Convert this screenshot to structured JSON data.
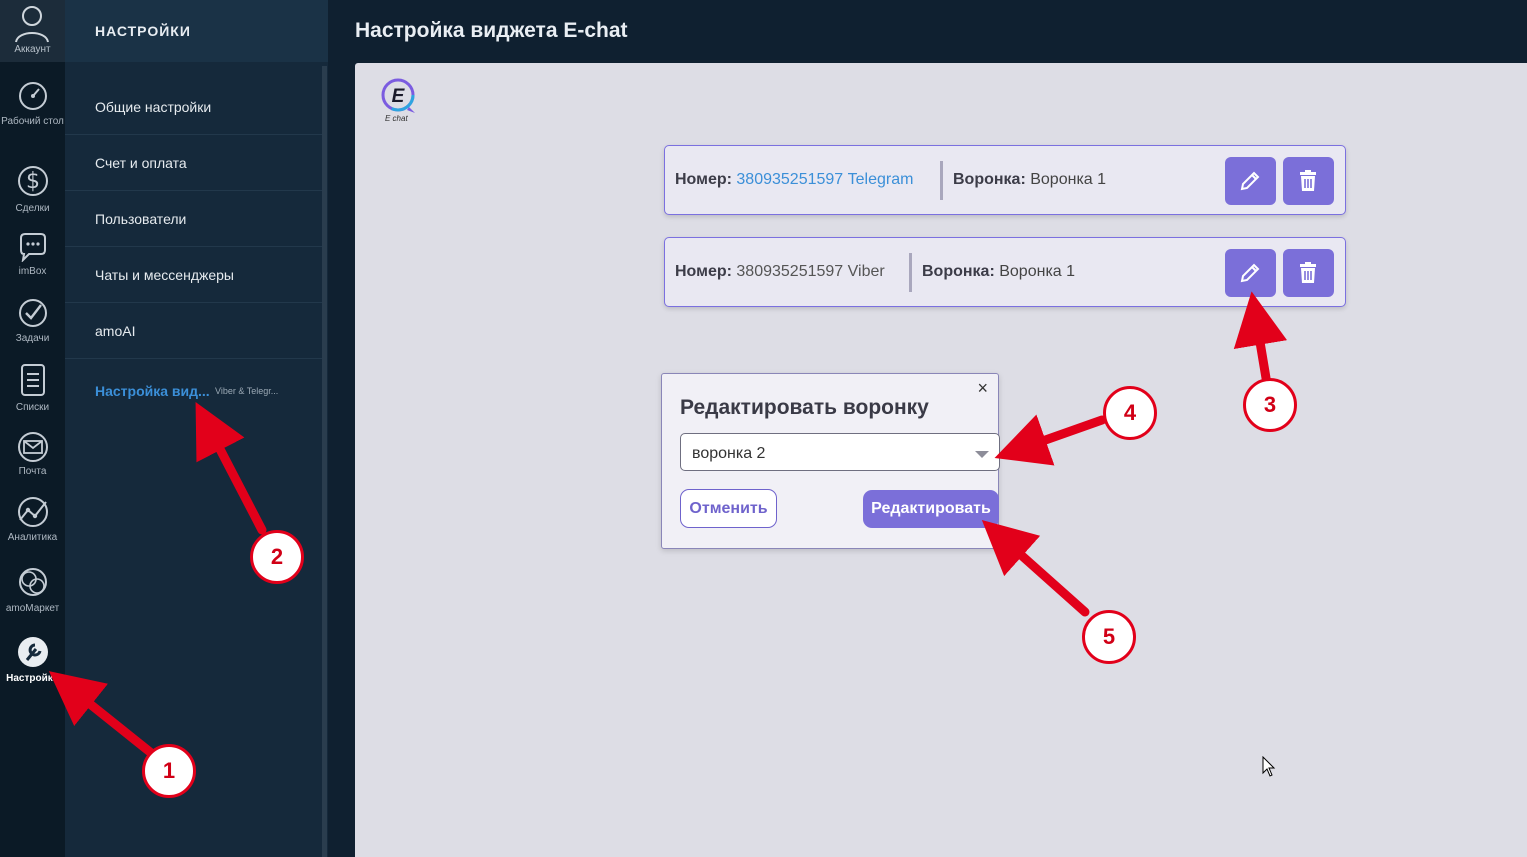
{
  "rail": {
    "account_label": "Аккаунт",
    "items": [
      {
        "label": "Рабочий стол",
        "icon": "dashboard-icon"
      },
      {
        "label": "Сделки",
        "icon": "dollar-icon"
      },
      {
        "label": "imBox",
        "icon": "chat-icon"
      },
      {
        "label": "Задачи",
        "icon": "check-icon"
      },
      {
        "label": "Списки",
        "icon": "list-icon"
      },
      {
        "label": "Почта",
        "icon": "mail-icon"
      },
      {
        "label": "Аналитика",
        "icon": "analytics-icon"
      },
      {
        "label": "amoМаркет",
        "icon": "market-icon"
      },
      {
        "label": "Настройки",
        "icon": "wrench-icon"
      }
    ]
  },
  "settings": {
    "title": "НАСТРОЙКИ",
    "menu": [
      {
        "label": "Общие настройки"
      },
      {
        "label": "Счет и оплата"
      },
      {
        "label": "Пользователи"
      },
      {
        "label": "Чаты и мессенджеры"
      },
      {
        "label": "amoAI"
      },
      {
        "label": "Настройка вид...",
        "sub": "Viber & Telegr..."
      }
    ]
  },
  "page": {
    "title": "Настройка виджета E-chat",
    "logo_text": "E chat",
    "logo_letter": "E"
  },
  "channels": [
    {
      "number_label": "Номер:",
      "number": "380935251597 Telegram",
      "funnel_label": "Воронка:",
      "funnel": "Воронка 1"
    },
    {
      "number_label": "Номер:",
      "number": "380935251597 Viber",
      "funnel_label": "Воронка:",
      "funnel": "Воронка 1"
    }
  ],
  "modal": {
    "title": "Редактировать воронку",
    "close": "×",
    "selected": "воронка 2",
    "cancel": "Отменить",
    "save": "Редактировать"
  },
  "annotations": [
    "1",
    "2",
    "3",
    "4",
    "5"
  ],
  "colors": {
    "accent": "#7b6fd9",
    "link": "#3b8fd8",
    "annotation": "#e2001a"
  }
}
